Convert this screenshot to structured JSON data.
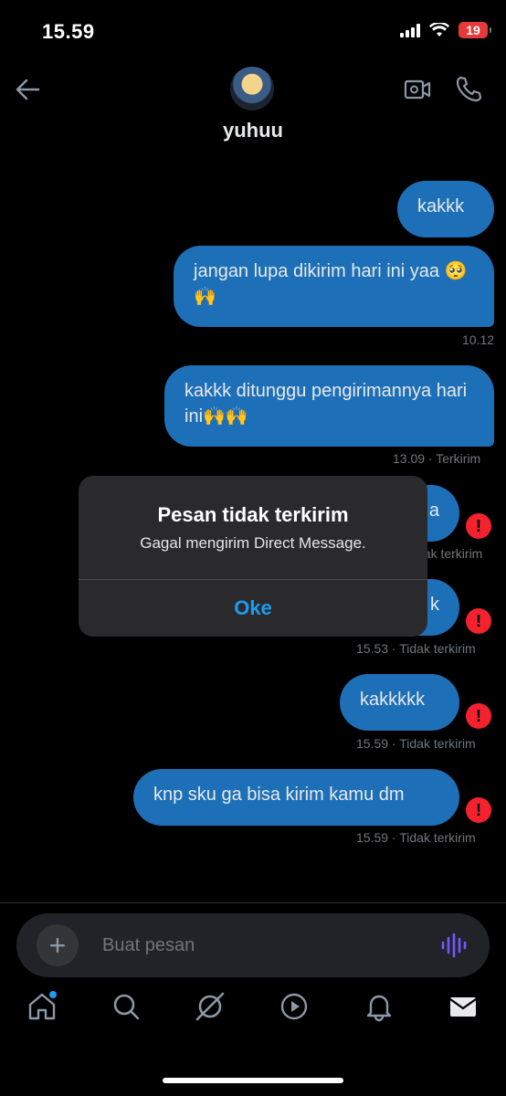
{
  "status_bar": {
    "time": "15.59",
    "battery": "19"
  },
  "header": {
    "username": "yuhuu"
  },
  "messages": [
    {
      "text": "kakkk",
      "meta": ""
    },
    {
      "text": "jangan lupa dikirim hari ini yaa 🥺🙌",
      "meta": "10.12"
    },
    {
      "text": "kakkk ditunggu pengirimannya hari ini🙌🙌",
      "meta": "13.09 · Terkirim"
    },
    {
      "text": "a",
      "meta": "dak terkirim"
    },
    {
      "text": "k",
      "meta": "15.53 · Tidak terkirim"
    },
    {
      "text": "kakkkkk",
      "meta": "15.59 · Tidak terkirim"
    },
    {
      "text": "knp sku ga bisa kirim kamu dm",
      "meta": "15.59 · Tidak terkirim"
    }
  ],
  "dialog": {
    "title": "Pesan tidak terkirim",
    "message": "Gagal mengirim Direct Message.",
    "ok_label": "Oke"
  },
  "composer": {
    "placeholder": "Buat pesan"
  },
  "colors": {
    "accent": "#1d9bf0",
    "bubble": "#1d70b8",
    "error": "#f4212e"
  },
  "nav": {
    "items": [
      "home-icon",
      "search-icon",
      "grok-icon",
      "video-icon",
      "notifications-icon",
      "messages-icon"
    ]
  }
}
